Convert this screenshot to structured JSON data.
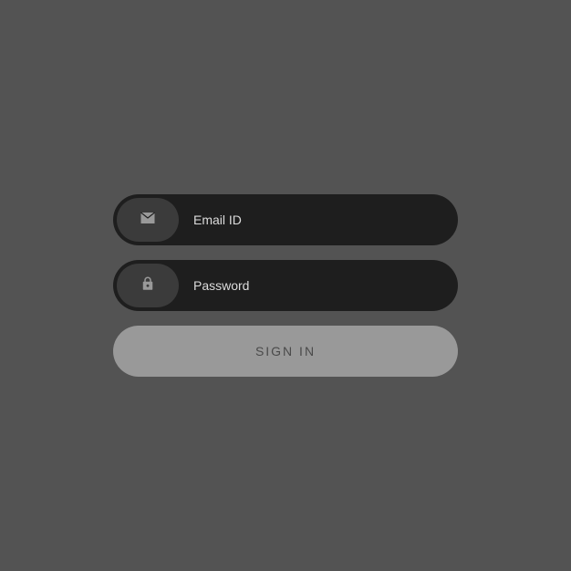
{
  "email": {
    "placeholder": "Email ID",
    "value": ""
  },
  "password": {
    "placeholder": "Password",
    "value": ""
  },
  "signin_button_label": "SIGN IN"
}
